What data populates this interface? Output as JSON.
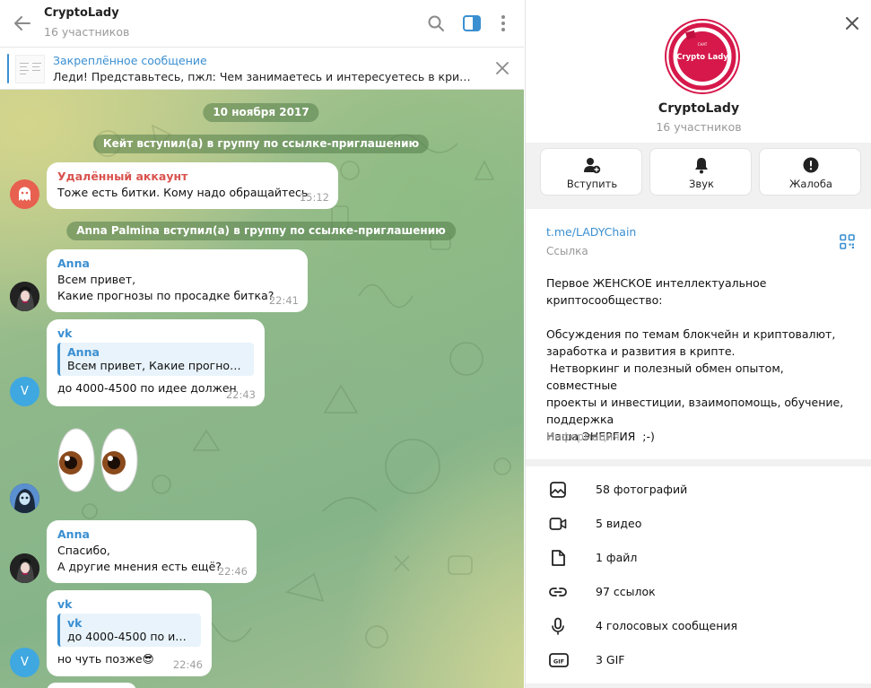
{
  "header": {
    "title": "CryptoLady",
    "subtitle": "16 участников"
  },
  "pinned": {
    "title": "Закреплённое сообщение",
    "text": "Леди! Представьтесь, пжл: Чем занимаетесь и интересуетесь в крипте и т..."
  },
  "messages": {
    "date": "10 ноября 2017",
    "service1": "Кейт вступил(а) в группу по ссылке-приглашению",
    "m1": {
      "name": "Удалённый аккаунт",
      "text": "Тоже есть битки. Кому надо обращайтесь",
      "time": "15:12"
    },
    "service2": "Anna Palmina вступил(а) в группу по ссылке-приглашению",
    "m2": {
      "name": "Anna",
      "line1": "Всем привет,",
      "line2": "Какие прогнозы по просадке битка?",
      "time": "22:41"
    },
    "m3": {
      "name": "vk",
      "reply_name": "Anna",
      "reply_text": "Всем привет, Какие прогнозы ...",
      "text": "до 4000-4500 по идее должен",
      "time": "22:43"
    },
    "m4": {
      "emoji": "eyes-emoji"
    },
    "m5": {
      "name": "Anna",
      "line1": "Спасибо,",
      "line2": "А другие мнения есть ещё?",
      "time": "22:46"
    },
    "m6": {
      "name": "vk",
      "reply_name": "vk",
      "reply_text": "до 4000-4500 по идее ...",
      "text": "но чуть позже😎",
      "time": "22:46"
    },
    "avatar_v": "V"
  },
  "colors": {
    "accent": "#3a8fd1",
    "deleted_name": "#d9534f",
    "anna_name": "#3a8fd1",
    "vk_name": "#3a8fd1",
    "logo": "#d6184a"
  },
  "info": {
    "logo_small": "CHAT",
    "logo_text": "Crypto Lady",
    "title": "CryptoLady",
    "subtitle": "16 участников",
    "actions": [
      "Вступить",
      "Звук",
      "Жалоба"
    ],
    "link": "t.me/LADYChain",
    "link_label": "Ссылка",
    "description": "Первое ЖЕНСКОЕ интеллектуальное\nкриптосообщество:\n\nОбсуждения по темам блокчейн и криптовалют,\nзаработка и развития в крипте.\n Нетворкинг и полезный обмен опытом, совместные\nпроекты и инвестиции, взаимопомощь, обучение,\nподдержка\nНаша ЭНЕРГИЯ  ;-)",
    "description_label": "Информация",
    "media": [
      "58 фотографий",
      "5 видео",
      "1 файл",
      "97 ссылок",
      "4 голосовых сообщения",
      "3 GIF"
    ]
  }
}
